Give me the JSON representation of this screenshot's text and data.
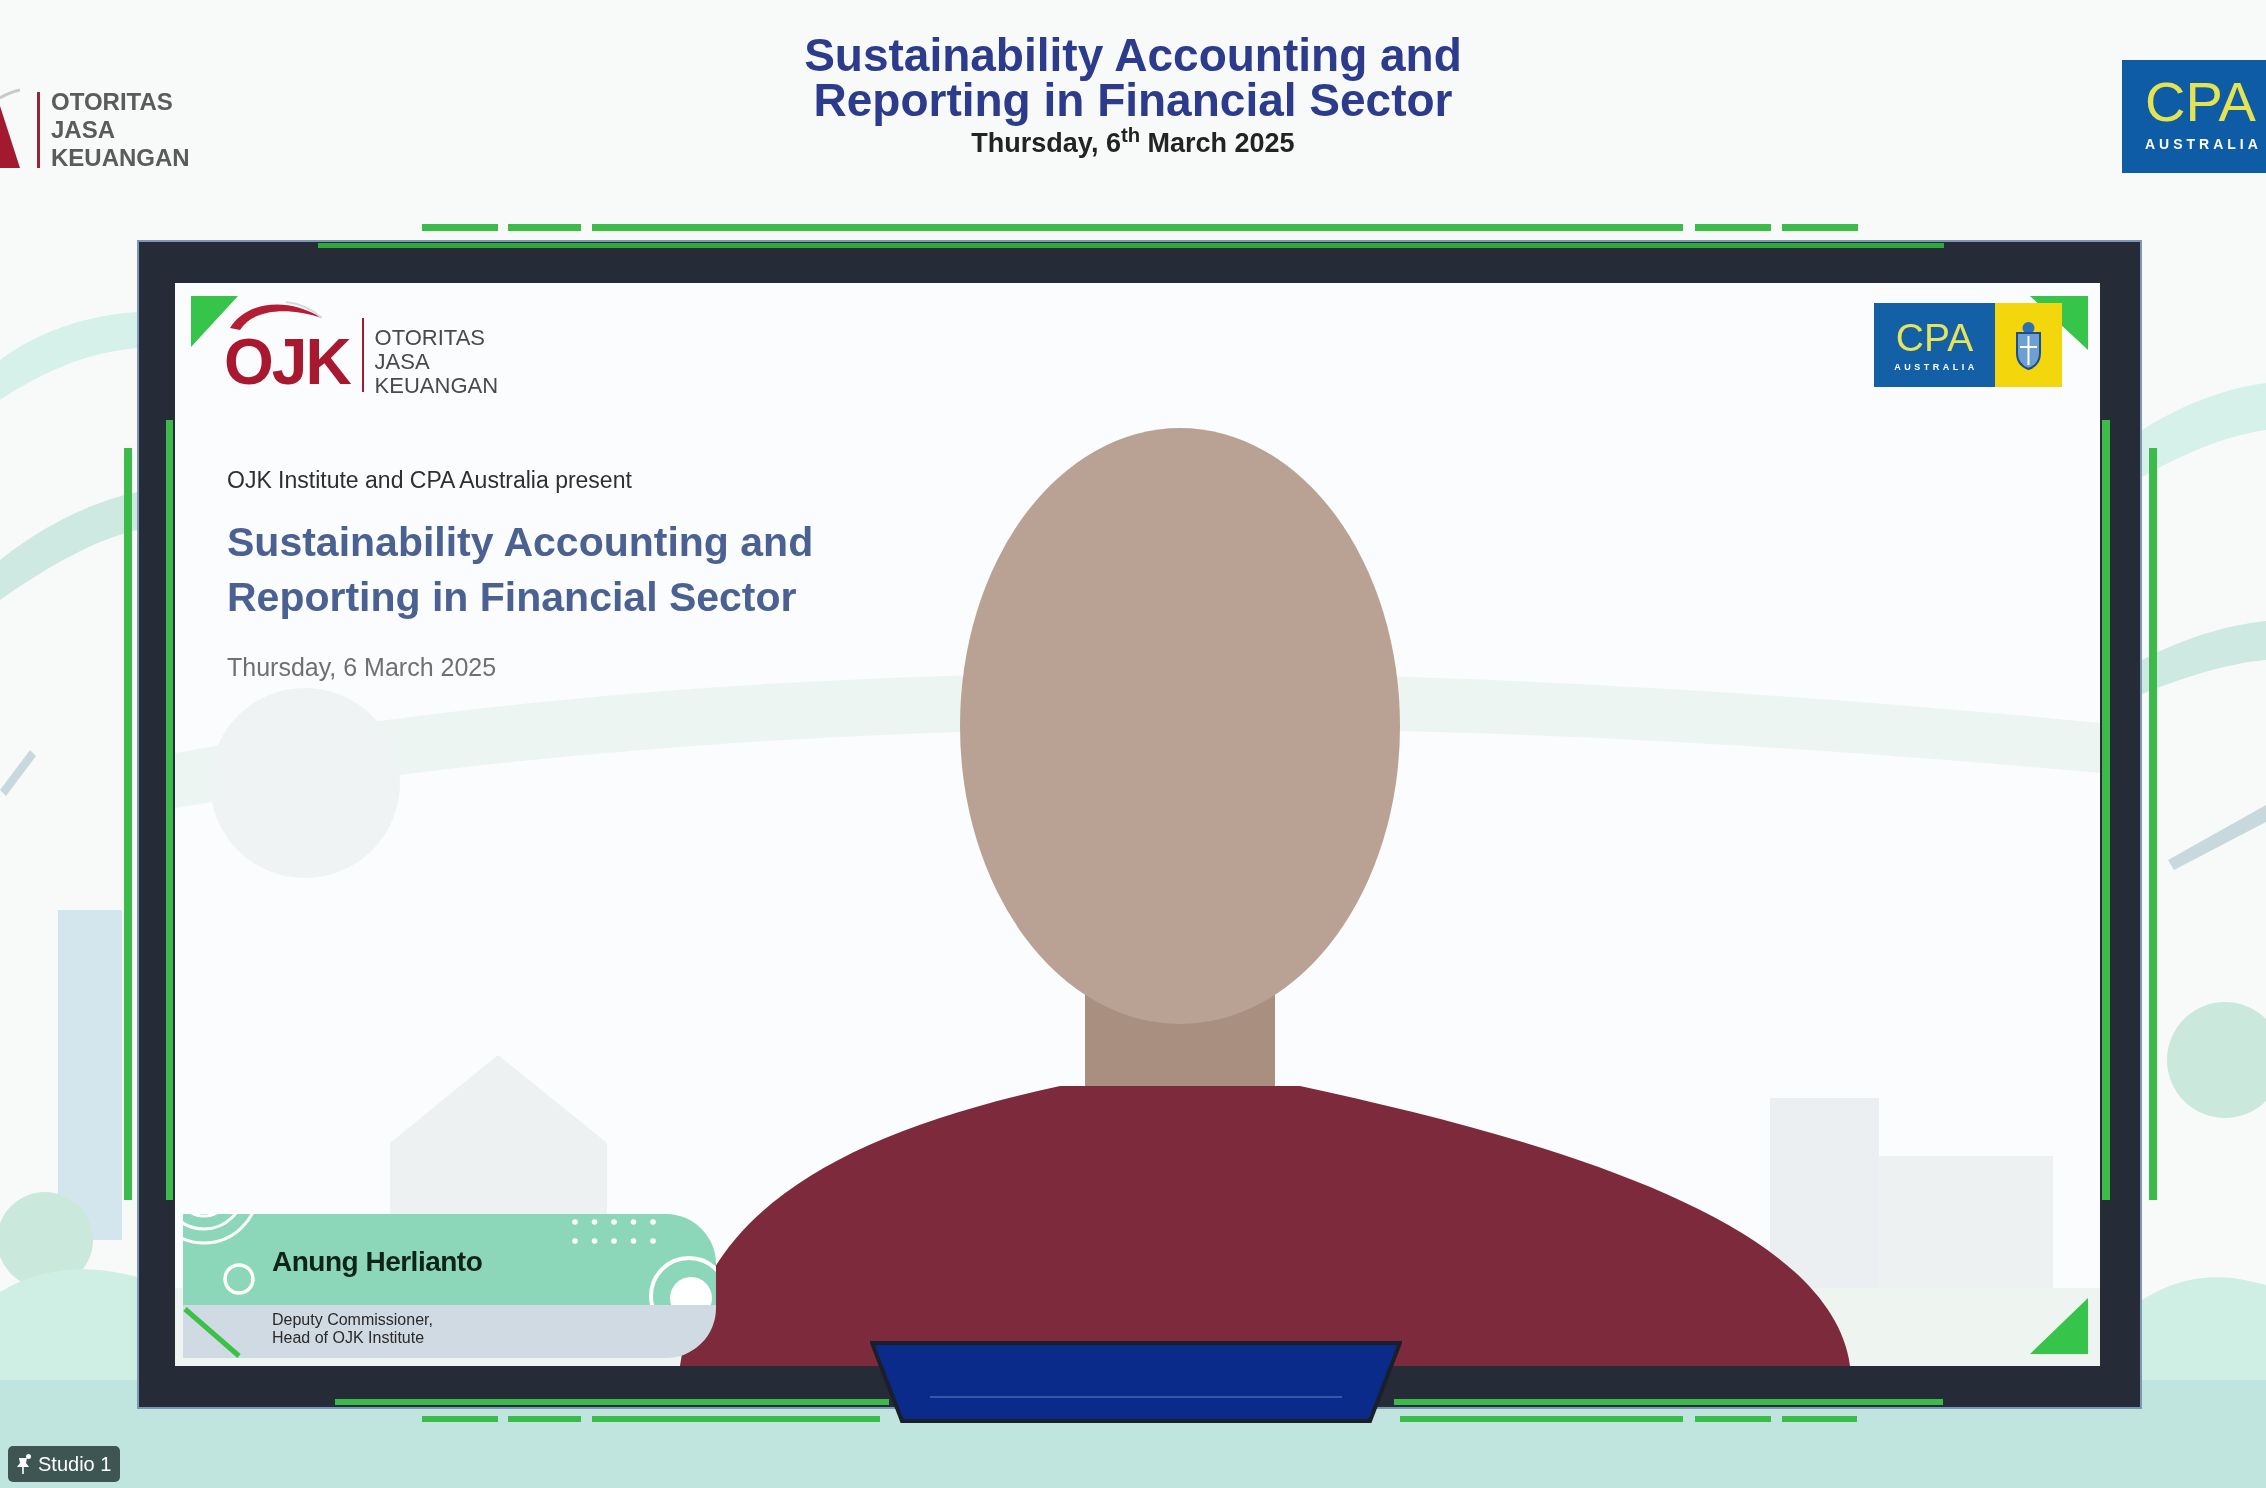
{
  "header": {
    "left_logo": {
      "lines": [
        "OTORITAS",
        "JASA",
        "KEUANGAN"
      ]
    },
    "title_lines": [
      "Sustainability Accounting and",
      "Reporting in Financial Sector"
    ],
    "date": "Thursday, 6$^{th}$ March 2025",
    "right_logo": {
      "wordmark": "CPA",
      "subtitle": "AUSTRALIA"
    }
  },
  "screen": {
    "left_logo": {
      "wordmark": "OJK",
      "lines": [
        "OTORITAS",
        "JASA",
        "KEUANGAN"
      ]
    },
    "right_logo": {
      "wordmark": "CPA",
      "subtitle": "AUSTRALIA"
    },
    "intro": "OJK Institute and CPA Australia present",
    "title_lines": [
      "Sustainability Accounting and",
      "Reporting in Financial Sector"
    ],
    "date": "Thursday, 6 March 2025",
    "speaker": {
      "name": "Anung Herlianto",
      "role_lines": [
        "Deputy Commissioner,",
        "Head of OJK Institute"
      ]
    }
  },
  "studio_label": "Studio 1"
}
